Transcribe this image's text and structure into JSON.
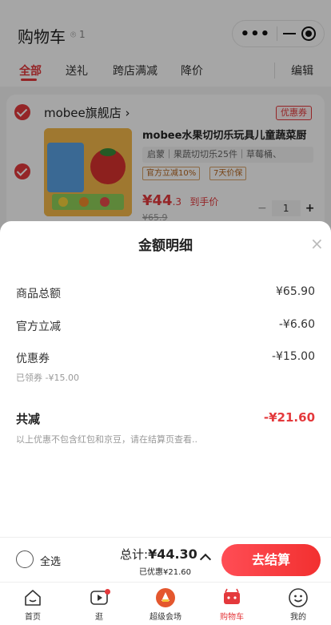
{
  "header": {
    "title": "购物车",
    "location_count": "1"
  },
  "tabs": [
    {
      "label": "全部"
    },
    {
      "label": "送礼"
    },
    {
      "label": "跨店满减"
    },
    {
      "label": "降价"
    }
  ],
  "edit_label": "编辑",
  "shop": {
    "name": "mobee旗舰店 ›",
    "coupon_chip": "优惠券"
  },
  "product": {
    "title": "mobee水果切切乐玩具儿童蔬菜厨",
    "spec": "启蒙｜果蔬切切乐25件｜草莓桶、",
    "tags": [
      "官方立减10%",
      "7天价保"
    ],
    "price_main": "¥44",
    "price_dec": ".3",
    "price_suffix": "到手价",
    "old_price": "¥65.9",
    "quantity": "1",
    "minus": "−",
    "plus": "+"
  },
  "sheet": {
    "title": "金额明细",
    "close": "×",
    "rows": [
      {
        "label": "商品总额",
        "value": "¥65.90"
      },
      {
        "label": "官方立减",
        "value": "-¥6.60"
      },
      {
        "label": "优惠券",
        "value": "-¥15.00",
        "sub": "已领券 -¥15.00"
      }
    ],
    "total_label": "共减",
    "total_value": "-¥21.60",
    "note": "以上优惠不包含红包和京豆，请在结算页查看.."
  },
  "checkout": {
    "select_all": "全选",
    "total_prefix": "总计:",
    "total_value": "¥44.30",
    "saved": "已优惠¥21.60",
    "button": "去结算"
  },
  "tabbar": [
    {
      "label": "首页",
      "icon": "home-icon"
    },
    {
      "label": "逛",
      "icon": "play-icon"
    },
    {
      "label": "超级会场",
      "icon": "venue-icon"
    },
    {
      "label": "购物车",
      "icon": "cart-icon"
    },
    {
      "label": "我的",
      "icon": "profile-icon"
    }
  ],
  "colors": {
    "accent": "#e4393c"
  }
}
